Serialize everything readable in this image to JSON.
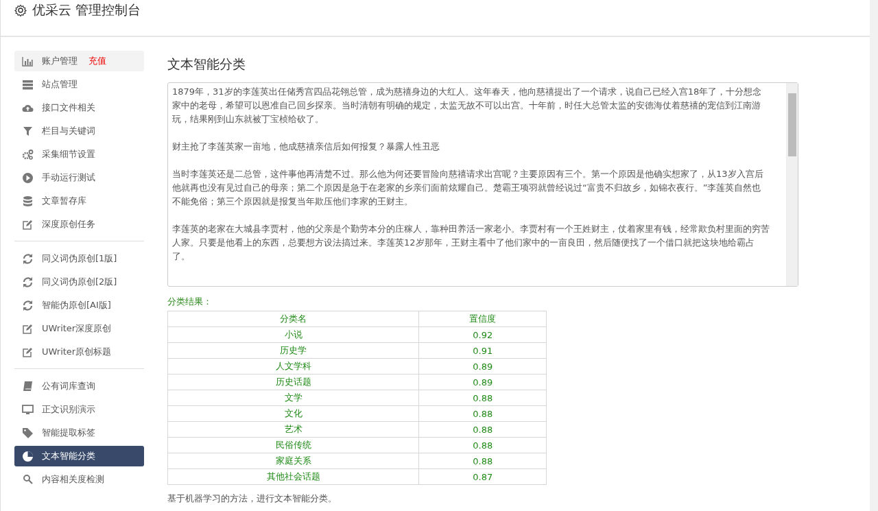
{
  "header": {
    "title": "优采云 管理控制台"
  },
  "sidebar": {
    "groups": [
      [
        {
          "label": "账户管理",
          "badge": "充值",
          "hovered": true,
          "selected": false
        },
        {
          "label": "站点管理",
          "hovered": false,
          "selected": false
        },
        {
          "label": "接口文件相关",
          "hovered": false,
          "selected": false
        },
        {
          "label": "栏目与关键词",
          "hovered": false,
          "selected": false
        },
        {
          "label": "采集细节设置",
          "hovered": false,
          "selected": false
        },
        {
          "label": "手动运行测试",
          "hovered": false,
          "selected": false
        },
        {
          "label": "文章暂存库",
          "hovered": false,
          "selected": false
        },
        {
          "label": "深度原创任务",
          "hovered": false,
          "selected": false
        }
      ],
      [
        {
          "label": "同义词伪原创[1版]",
          "hovered": false,
          "selected": false
        },
        {
          "label": "同义词伪原创[2版]",
          "hovered": false,
          "selected": false
        },
        {
          "label": "智能伪原创[AI版]",
          "hovered": false,
          "selected": false
        },
        {
          "label": "UWriter深度原创",
          "hovered": false,
          "selected": false
        },
        {
          "label": "UWriter原创标题",
          "hovered": false,
          "selected": false
        }
      ],
      [
        {
          "label": "公有词库查询",
          "hovered": false,
          "selected": false
        },
        {
          "label": "正文识别演示",
          "hovered": false,
          "selected": false
        },
        {
          "label": "智能提取标签",
          "hovered": false,
          "selected": false
        },
        {
          "label": "文本智能分类",
          "hovered": false,
          "selected": true
        },
        {
          "label": "内容相关度检测",
          "hovered": false,
          "selected": false
        }
      ]
    ]
  },
  "main": {
    "heading": "文本智能分类",
    "input_text": [
      "1879年，31岁的李莲英出任储秀宫四品花翎总管，成为慈禧身边的大红人。这年春天，他向慈禧提出了一个请求，说自己已经入宫18年了，十分想念家中的老母，希望可以恩准自己回乡探亲。当时清朝有明确的规定，太监无故不可以出宫。十年前，时任大总管太监的安德海仗着慈禧的宠信到江南游玩，结果刚到山东就被丁宝桢给砍了。",
      "财主抢了李莲英家一亩地，他成慈禧亲信后如何报复？暴露人性丑恶",
      "当时李莲英还是二总管，这件事他再清楚不过。那么他为何还要冒险向慈禧请求出宫呢？主要原因有三个。第一个原因是他确实想家了，从13岁入宫后他就再也没有见过自己的母亲；第二个原因是急于在老家的乡亲们面前炫耀自己。楚霸王项羽就曾经说过“富贵不归故乡，如锦衣夜行。”李莲英自然也不能免俗；第三个原因就是报复当年欺压他们李家的王财主。",
      "李莲英的老家在大城县李贾村，他的父亲是个勤劳本分的庄稼人，靠种田养活一家老小。李贾村有一个王姓财主，仗着家里有钱，经常欺负村里面的穷苦人家。只要是他看上的东西，总要想方设法搞过来。李莲英12岁那年，王财主看中了他们家中的一亩良田，然后随便找了一个借口就把这块地给霸占了。"
    ],
    "result_label": "分类结果：",
    "table": {
      "columns": [
        "分类名",
        "置信度"
      ],
      "rows": [
        [
          "小说",
          "0.92"
        ],
        [
          "历史学",
          "0.91"
        ],
        [
          "人文学科",
          "0.89"
        ],
        [
          "历史话题",
          "0.89"
        ],
        [
          "文学",
          "0.88"
        ],
        [
          "文化",
          "0.88"
        ],
        [
          "艺术",
          "0.88"
        ],
        [
          "民俗传统",
          "0.88"
        ],
        [
          "家庭关系",
          "0.88"
        ],
        [
          "其他社会话题",
          "0.87"
        ]
      ]
    },
    "description": "基于机器学习的方法，进行文本智能分类。"
  }
}
